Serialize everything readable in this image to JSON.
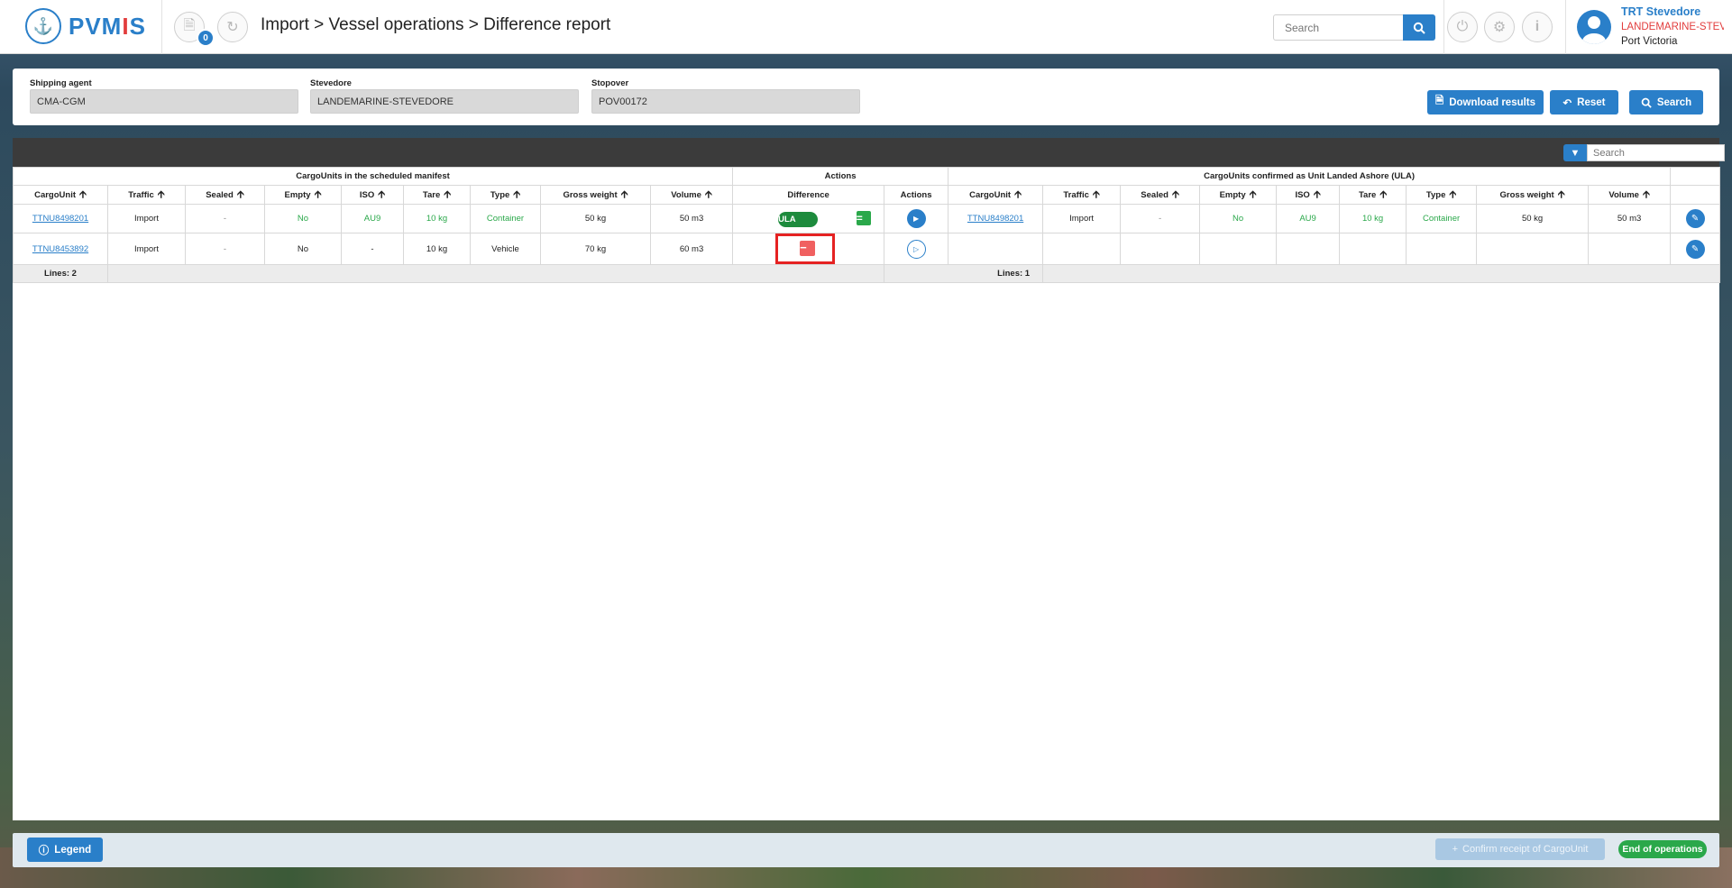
{
  "app": {
    "logo_text_a": "PVM",
    "logo_text_b": "I",
    "logo_text_c": "S",
    "brand_color": "#2a7fc9"
  },
  "header": {
    "breadcrumb": "Import > Vessel operations > Difference report",
    "notification_count": "0",
    "search_placeholder": "Search",
    "icons": [
      "document-icon",
      "refresh-icon",
      "power-icon",
      "settings-icon",
      "info-icon"
    ]
  },
  "user": {
    "name": "TRT Stevedore",
    "company": "LANDEMARINE-STEVE",
    "port": "Port Victoria"
  },
  "filters": {
    "shipping_agent": {
      "label": "Shipping agent",
      "value": "CMA-CGM"
    },
    "stevedore": {
      "label": "Stevedore",
      "value": "LANDEMARINE-STEVEDORE"
    },
    "stopover": {
      "label": "Stopover",
      "value": "POV00172"
    },
    "buttons": {
      "download": "Download results",
      "reset": "Reset",
      "search": "Search"
    }
  },
  "table": {
    "search_placeholder": "Search",
    "groups": {
      "manifest": "CargoUnits in the scheduled manifest",
      "actions": "Actions",
      "ula": "CargoUnits confirmed as Unit Landed Ashore (ULA)"
    },
    "columns": {
      "cargounit": "CargoUnit",
      "traffic": "Traffic",
      "sealed": "Sealed",
      "empty": "Empty",
      "iso": "ISO",
      "tare": "Tare",
      "type": "Type",
      "gross_weight": "Gross weight",
      "volume": "Volume",
      "difference": "Difference",
      "actions": "Actions"
    },
    "rows": [
      {
        "left": {
          "cargounit": "TTNU8498201",
          "traffic": "Import",
          "sealed": "-",
          "empty": "No",
          "iso": "AU9",
          "tare": "10 kg",
          "type": "Container",
          "gross_weight": "50 kg",
          "volume": "50 m3"
        },
        "difference": "ULA",
        "equal_symbol": "=",
        "right": {
          "cargounit": "TTNU8498201",
          "traffic": "Import",
          "sealed": "-",
          "empty": "No",
          "iso": "AU9",
          "tare": "10 kg",
          "type": "Container",
          "gross_weight": "50 kg",
          "volume": "50 m3"
        }
      },
      {
        "left": {
          "cargounit": "TTNU8453892",
          "traffic": "Import",
          "sealed": "-",
          "empty": "No",
          "iso": "-",
          "tare": "10 kg",
          "type": "Vehicle",
          "gross_weight": "70 kg",
          "volume": "60 m3"
        },
        "difference_symbol": "−"
      }
    ],
    "lines_left": "Lines: 2",
    "lines_right": "Lines: 1"
  },
  "bottom": {
    "legend": "Legend",
    "confirm": "Confirm receipt of CargoUnit",
    "end": "End of operations"
  },
  "colors": {
    "primary": "#2a7fc9",
    "success": "#2aa84a",
    "danger": "#e52222",
    "ula_pill": "#1d8b3d"
  }
}
